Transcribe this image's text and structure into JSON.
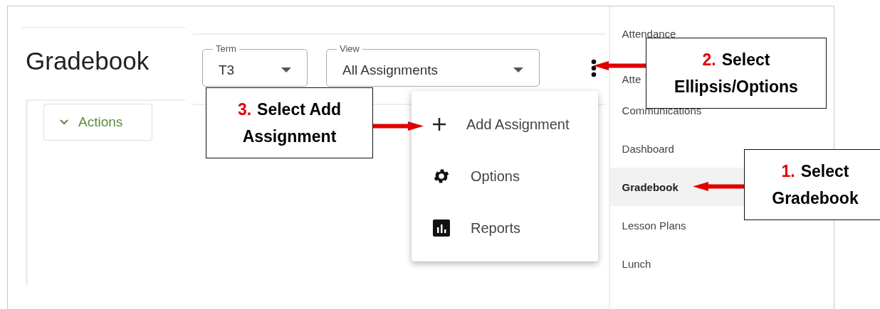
{
  "page": {
    "title": "Gradebook"
  },
  "filters": [
    {
      "label": "Term",
      "value": "T3"
    },
    {
      "label": "View",
      "value": "All Assignments"
    }
  ],
  "actions_button": "Actions",
  "menu": [
    {
      "label": "Add Assignment",
      "kind": "plus"
    },
    {
      "label": "Options",
      "kind": "gear"
    },
    {
      "label": "Reports",
      "kind": "chart"
    }
  ],
  "sidebar": {
    "items": [
      {
        "label": "Attendance",
        "selected": false
      },
      {
        "label": "Atte",
        "selected": false
      },
      {
        "label": "Communications",
        "selected": false
      },
      {
        "label": "Dashboard",
        "selected": false
      },
      {
        "label": "Gradebook",
        "selected": true
      },
      {
        "label": "Lesson Plans",
        "selected": false
      },
      {
        "label": "Lunch",
        "selected": false
      }
    ]
  },
  "callouts": [
    {
      "number": "2.",
      "text": "Select Ellipsis/Options"
    },
    {
      "number": "3.",
      "text": "Select Add Assignment"
    },
    {
      "number": "1.",
      "text": "Select Gradebook"
    }
  ]
}
